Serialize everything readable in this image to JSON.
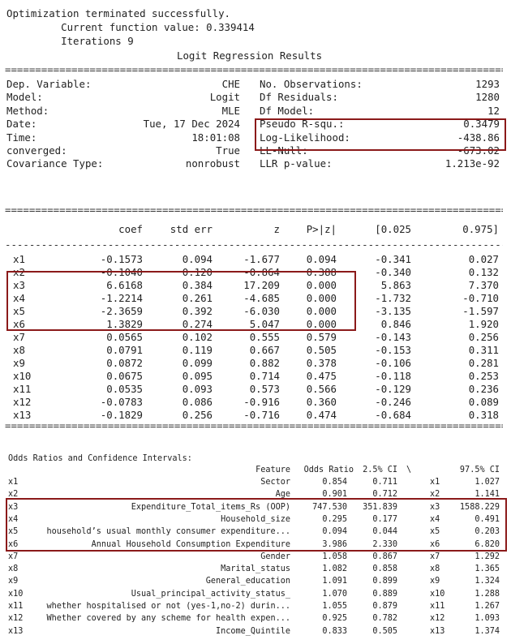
{
  "summary": {
    "status": "Optimization terminated successfully.",
    "func_line": "         Current function value: 0.339414",
    "iter_line": "         Iterations 9",
    "title": "Logit Regression Results",
    "left_rows": [
      {
        "label": "Dep. Variable:",
        "value": "CHE"
      },
      {
        "label": "Model:",
        "value": "Logit"
      },
      {
        "label": "Method:",
        "value": "MLE"
      },
      {
        "label": "Date:",
        "value": "Tue, 17 Dec 2024"
      },
      {
        "label": "Time:",
        "value": "18:01:08"
      },
      {
        "label": "converged:",
        "value": "True"
      },
      {
        "label": "Covariance Type:",
        "value": "nonrobust"
      }
    ],
    "right_rows": [
      {
        "label": "No. Observations:",
        "value": "1293"
      },
      {
        "label": "Df Residuals:",
        "value": "1280"
      },
      {
        "label": "Df Model:",
        "value": "12"
      },
      {
        "label": "Pseudo R-squ.:",
        "value": "0.3479"
      },
      {
        "label": "Log-Likelihood:",
        "value": "-438.86"
      },
      {
        "label": "LL-Null:",
        "value": "-673.02"
      },
      {
        "label": "LLR p-value:",
        "value": "1.213e-92"
      }
    ]
  },
  "coef_table": {
    "headers": [
      "coef",
      "std err",
      "z",
      "P>|z|",
      "[0.025",
      "0.975]"
    ],
    "rows": [
      {
        "name": "x1",
        "values": [
          "-0.1573",
          "0.094",
          "-1.677",
          "0.094",
          "-0.341",
          "0.027"
        ]
      },
      {
        "name": "x2",
        "values": [
          "-0.1040",
          "0.120",
          "-0.864",
          "0.388",
          "-0.340",
          "0.132"
        ]
      },
      {
        "name": "x3",
        "values": [
          "6.6168",
          "0.384",
          "17.209",
          "0.000",
          "5.863",
          "7.370"
        ]
      },
      {
        "name": "x4",
        "values": [
          "-1.2214",
          "0.261",
          "-4.685",
          "0.000",
          "-1.732",
          "-0.710"
        ]
      },
      {
        "name": "x5",
        "values": [
          "-2.3659",
          "0.392",
          "-6.030",
          "0.000",
          "-3.135",
          "-1.597"
        ]
      },
      {
        "name": "x6",
        "values": [
          "1.3829",
          "0.274",
          "5.047",
          "0.000",
          "0.846",
          "1.920"
        ]
      },
      {
        "name": "x7",
        "values": [
          "0.0565",
          "0.102",
          "0.555",
          "0.579",
          "-0.143",
          "0.256"
        ]
      },
      {
        "name": "x8",
        "values": [
          "0.0791",
          "0.119",
          "0.667",
          "0.505",
          "-0.153",
          "0.311"
        ]
      },
      {
        "name": "x9",
        "values": [
          "0.0872",
          "0.099",
          "0.882",
          "0.378",
          "-0.106",
          "0.281"
        ]
      },
      {
        "name": "x10",
        "values": [
          "0.0675",
          "0.095",
          "0.714",
          "0.475",
          "-0.118",
          "0.253"
        ]
      },
      {
        "name": "x11",
        "values": [
          "0.0535",
          "0.093",
          "0.573",
          "0.566",
          "-0.129",
          "0.236"
        ]
      },
      {
        "name": "x12",
        "values": [
          "-0.0783",
          "0.086",
          "-0.916",
          "0.360",
          "-0.246",
          "0.089"
        ]
      },
      {
        "name": "x13",
        "values": [
          "-0.1829",
          "0.256",
          "-0.716",
          "0.474",
          "-0.684",
          "0.318"
        ]
      }
    ]
  },
  "odds": {
    "title": "Odds Ratios and Confidence Intervals:",
    "headers": {
      "feature": "Feature",
      "odds": "Odds Ratio",
      "lo": "2.5% CI",
      "slash": "\\",
      "hi": "97.5% CI"
    },
    "rows": [
      {
        "idx": "x1",
        "feature": "Sector",
        "odds": "0.854",
        "lo": "0.711",
        "idx2": "x1",
        "hi": "1.027"
      },
      {
        "idx": "x2",
        "feature": "Age",
        "odds": "0.901",
        "lo": "0.712",
        "idx2": "x2",
        "hi": "1.141"
      },
      {
        "idx": "x3",
        "feature": "Expenditure_Total_items_Rs (OOP)",
        "odds": "747.530",
        "lo": "351.839",
        "idx2": "x3",
        "hi": "1588.229"
      },
      {
        "idx": "x4",
        "feature": "Household_size",
        "odds": "0.295",
        "lo": "0.177",
        "idx2": "x4",
        "hi": "0.491"
      },
      {
        "idx": "x5",
        "feature": "household’s usual monthly consumer expenditure...",
        "odds": "0.094",
        "lo": "0.044",
        "idx2": "x5",
        "hi": "0.203"
      },
      {
        "idx": "x6",
        "feature": "Annual Household Consumption Expenditure",
        "odds": "3.986",
        "lo": "2.330",
        "idx2": "x6",
        "hi": "6.820"
      },
      {
        "idx": "x7",
        "feature": "Gender",
        "odds": "1.058",
        "lo": "0.867",
        "idx2": "x7",
        "hi": "1.292"
      },
      {
        "idx": "x8",
        "feature": "Marital_status",
        "odds": "1.082",
        "lo": "0.858",
        "idx2": "x8",
        "hi": "1.365"
      },
      {
        "idx": "x9",
        "feature": "General_education",
        "odds": "1.091",
        "lo": "0.899",
        "idx2": "x9",
        "hi": "1.324"
      },
      {
        "idx": "x10",
        "feature": "Usual_principal_activity_status_",
        "odds": "1.070",
        "lo": "0.889",
        "idx2": "x10",
        "hi": "1.288"
      },
      {
        "idx": "x11",
        "feature": "whether hospitalised or not (yes-1,no-2) durin...",
        "odds": "1.055",
        "lo": "0.879",
        "idx2": "x11",
        "hi": "1.267"
      },
      {
        "idx": "x12",
        "feature": "Whether covered by any scheme for health expen...",
        "odds": "0.925",
        "lo": "0.782",
        "idx2": "x12",
        "hi": "1.093"
      },
      {
        "idx": "x13",
        "feature": "Income_Quintile",
        "odds": "0.833",
        "lo": "0.505",
        "idx2": "x13",
        "hi": "1.374"
      }
    ]
  },
  "colors": {
    "highlight_box": "#8b1a1a"
  }
}
